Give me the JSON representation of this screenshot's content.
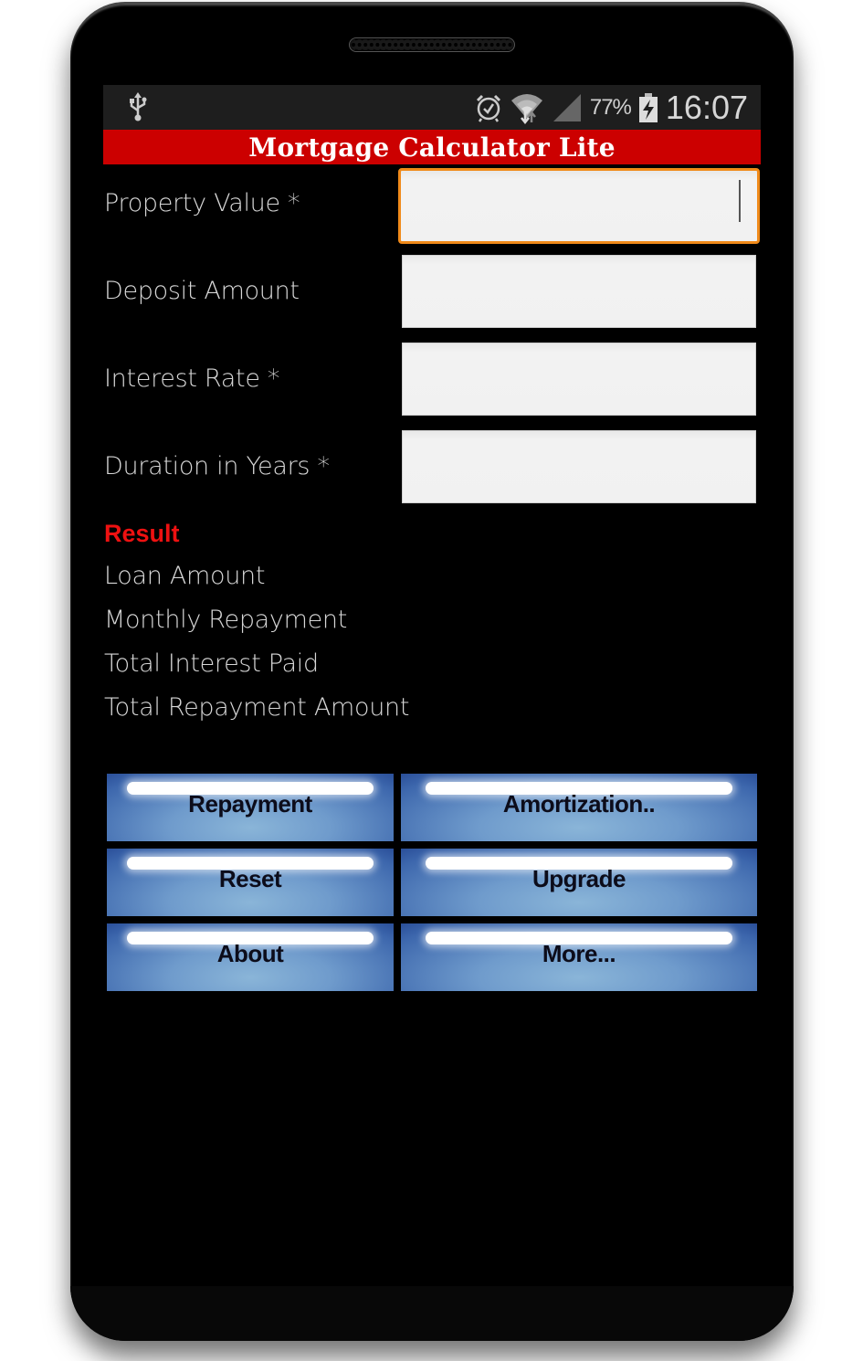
{
  "status_bar": {
    "left_icons": [
      "usb-icon"
    ],
    "right_icons": [
      "alarm-icon",
      "wifi-icon",
      "signal-icon",
      "battery-charging-icon"
    ],
    "battery_percent": "77%",
    "time": "16:07"
  },
  "app": {
    "title": "Mortgage Calculator Lite",
    "title_bar_color": "#cc0000"
  },
  "form": {
    "fields": [
      {
        "label": "Property Value *",
        "value": "",
        "focused": true
      },
      {
        "label": "Deposit Amount",
        "value": "",
        "focused": false
      },
      {
        "label": "Interest Rate *",
        "value": "",
        "focused": false
      },
      {
        "label": "Duration in Years *",
        "value": "",
        "focused": false
      }
    ],
    "focus_color": "#f08a1a"
  },
  "result": {
    "title": "Result",
    "title_color": "#ee1111",
    "lines": [
      "Loan Amount",
      "Monthly Repayment",
      "Total Interest Paid",
      "Total Repayment Amount"
    ]
  },
  "buttons": [
    {
      "label": "Repayment"
    },
    {
      "label": "Amortization.."
    },
    {
      "label": "Reset"
    },
    {
      "label": "Upgrade"
    },
    {
      "label": "About"
    },
    {
      "label": "More..."
    }
  ]
}
